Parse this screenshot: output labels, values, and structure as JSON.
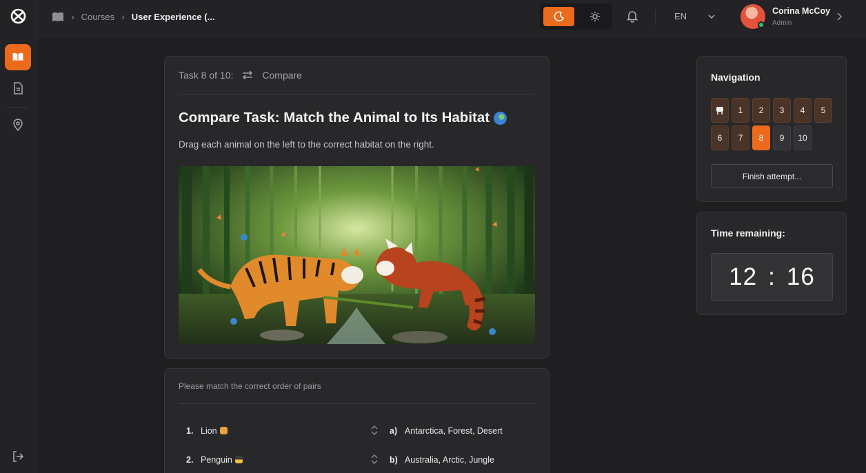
{
  "sidebar": {
    "items": [
      {
        "icon": "book-open-icon",
        "active": true
      },
      {
        "icon": "document-icon",
        "active": false
      },
      {
        "icon": "map-pin-icon",
        "active": false
      }
    ],
    "logout_icon": "logout-icon"
  },
  "header": {
    "breadcrumb": [
      {
        "icon": "library-icon"
      },
      {
        "label": "Courses"
      },
      {
        "label": "User Experience (..."
      }
    ],
    "theme_toggle": {
      "options": [
        "moon-icon",
        "sun-icon"
      ],
      "selected": "dark"
    },
    "language": "EN",
    "user": {
      "name": "Corina McCoy",
      "role": "Admin",
      "online": true
    }
  },
  "task": {
    "counter": "Task 8 of 10:",
    "type": "Compare",
    "title": "Compare Task: Match the Animal to Its Habitat",
    "description": "Drag each animal on the left to the correct habitat on the right.",
    "image_alt": "Tiger and red panda in a bamboo forest"
  },
  "match": {
    "instruction": "Please match the correct order of pairs",
    "rows": [
      {
        "num": "1.",
        "animal": "Lion",
        "letter": "a)",
        "habitat": "Antarctica, Forest, Desert"
      },
      {
        "num": "2.",
        "animal": "Penguin",
        "letter": "b)",
        "habitat": "Australia, Arctic, Jungle"
      }
    ]
  },
  "navigation": {
    "title": "Navigation",
    "buttons": [
      {
        "label": "",
        "icon": "flag-icon",
        "state": "done"
      },
      {
        "label": "1",
        "state": "done"
      },
      {
        "label": "2",
        "state": "done"
      },
      {
        "label": "3",
        "state": "done"
      },
      {
        "label": "4",
        "state": "done"
      },
      {
        "label": "5",
        "state": "done"
      },
      {
        "label": "6",
        "state": "done"
      },
      {
        "label": "7",
        "state": "done"
      },
      {
        "label": "8",
        "state": "current"
      },
      {
        "label": "9",
        "state": "todo"
      },
      {
        "label": "10",
        "state": "todo"
      }
    ],
    "finish_label": "Finish attempt..."
  },
  "timer": {
    "title": "Time remaining:",
    "minutes": "12",
    "separator": ":",
    "seconds": "16"
  },
  "colors": {
    "accent": "#ec6a1c",
    "background": "#1f1f21",
    "card": "#28282a",
    "online": "#2ec36a"
  }
}
